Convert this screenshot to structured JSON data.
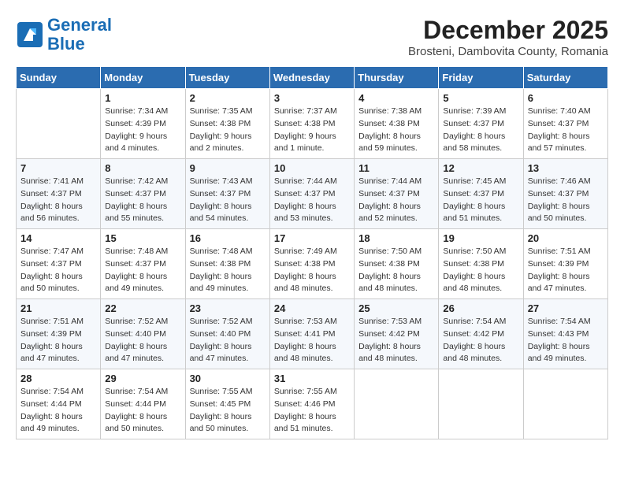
{
  "header": {
    "logo_line1": "General",
    "logo_line2": "Blue",
    "month_title": "December 2025",
    "subtitle": "Brosteni, Dambovita County, Romania"
  },
  "days_of_week": [
    "Sunday",
    "Monday",
    "Tuesday",
    "Wednesday",
    "Thursday",
    "Friday",
    "Saturday"
  ],
  "weeks": [
    [
      {
        "day": "",
        "sunrise": "",
        "sunset": "",
        "daylight": ""
      },
      {
        "day": "1",
        "sunrise": "Sunrise: 7:34 AM",
        "sunset": "Sunset: 4:39 PM",
        "daylight": "Daylight: 9 hours and 4 minutes."
      },
      {
        "day": "2",
        "sunrise": "Sunrise: 7:35 AM",
        "sunset": "Sunset: 4:38 PM",
        "daylight": "Daylight: 9 hours and 2 minutes."
      },
      {
        "day": "3",
        "sunrise": "Sunrise: 7:37 AM",
        "sunset": "Sunset: 4:38 PM",
        "daylight": "Daylight: 9 hours and 1 minute."
      },
      {
        "day": "4",
        "sunrise": "Sunrise: 7:38 AM",
        "sunset": "Sunset: 4:38 PM",
        "daylight": "Daylight: 8 hours and 59 minutes."
      },
      {
        "day": "5",
        "sunrise": "Sunrise: 7:39 AM",
        "sunset": "Sunset: 4:37 PM",
        "daylight": "Daylight: 8 hours and 58 minutes."
      },
      {
        "day": "6",
        "sunrise": "Sunrise: 7:40 AM",
        "sunset": "Sunset: 4:37 PM",
        "daylight": "Daylight: 8 hours and 57 minutes."
      }
    ],
    [
      {
        "day": "7",
        "sunrise": "Sunrise: 7:41 AM",
        "sunset": "Sunset: 4:37 PM",
        "daylight": "Daylight: 8 hours and 56 minutes."
      },
      {
        "day": "8",
        "sunrise": "Sunrise: 7:42 AM",
        "sunset": "Sunset: 4:37 PM",
        "daylight": "Daylight: 8 hours and 55 minutes."
      },
      {
        "day": "9",
        "sunrise": "Sunrise: 7:43 AM",
        "sunset": "Sunset: 4:37 PM",
        "daylight": "Daylight: 8 hours and 54 minutes."
      },
      {
        "day": "10",
        "sunrise": "Sunrise: 7:44 AM",
        "sunset": "Sunset: 4:37 PM",
        "daylight": "Daylight: 8 hours and 53 minutes."
      },
      {
        "day": "11",
        "sunrise": "Sunrise: 7:44 AM",
        "sunset": "Sunset: 4:37 PM",
        "daylight": "Daylight: 8 hours and 52 minutes."
      },
      {
        "day": "12",
        "sunrise": "Sunrise: 7:45 AM",
        "sunset": "Sunset: 4:37 PM",
        "daylight": "Daylight: 8 hours and 51 minutes."
      },
      {
        "day": "13",
        "sunrise": "Sunrise: 7:46 AM",
        "sunset": "Sunset: 4:37 PM",
        "daylight": "Daylight: 8 hours and 50 minutes."
      }
    ],
    [
      {
        "day": "14",
        "sunrise": "Sunrise: 7:47 AM",
        "sunset": "Sunset: 4:37 PM",
        "daylight": "Daylight: 8 hours and 50 minutes."
      },
      {
        "day": "15",
        "sunrise": "Sunrise: 7:48 AM",
        "sunset": "Sunset: 4:37 PM",
        "daylight": "Daylight: 8 hours and 49 minutes."
      },
      {
        "day": "16",
        "sunrise": "Sunrise: 7:48 AM",
        "sunset": "Sunset: 4:38 PM",
        "daylight": "Daylight: 8 hours and 49 minutes."
      },
      {
        "day": "17",
        "sunrise": "Sunrise: 7:49 AM",
        "sunset": "Sunset: 4:38 PM",
        "daylight": "Daylight: 8 hours and 48 minutes."
      },
      {
        "day": "18",
        "sunrise": "Sunrise: 7:50 AM",
        "sunset": "Sunset: 4:38 PM",
        "daylight": "Daylight: 8 hours and 48 minutes."
      },
      {
        "day": "19",
        "sunrise": "Sunrise: 7:50 AM",
        "sunset": "Sunset: 4:38 PM",
        "daylight": "Daylight: 8 hours and 48 minutes."
      },
      {
        "day": "20",
        "sunrise": "Sunrise: 7:51 AM",
        "sunset": "Sunset: 4:39 PM",
        "daylight": "Daylight: 8 hours and 47 minutes."
      }
    ],
    [
      {
        "day": "21",
        "sunrise": "Sunrise: 7:51 AM",
        "sunset": "Sunset: 4:39 PM",
        "daylight": "Daylight: 8 hours and 47 minutes."
      },
      {
        "day": "22",
        "sunrise": "Sunrise: 7:52 AM",
        "sunset": "Sunset: 4:40 PM",
        "daylight": "Daylight: 8 hours and 47 minutes."
      },
      {
        "day": "23",
        "sunrise": "Sunrise: 7:52 AM",
        "sunset": "Sunset: 4:40 PM",
        "daylight": "Daylight: 8 hours and 47 minutes."
      },
      {
        "day": "24",
        "sunrise": "Sunrise: 7:53 AM",
        "sunset": "Sunset: 4:41 PM",
        "daylight": "Daylight: 8 hours and 48 minutes."
      },
      {
        "day": "25",
        "sunrise": "Sunrise: 7:53 AM",
        "sunset": "Sunset: 4:42 PM",
        "daylight": "Daylight: 8 hours and 48 minutes."
      },
      {
        "day": "26",
        "sunrise": "Sunrise: 7:54 AM",
        "sunset": "Sunset: 4:42 PM",
        "daylight": "Daylight: 8 hours and 48 minutes."
      },
      {
        "day": "27",
        "sunrise": "Sunrise: 7:54 AM",
        "sunset": "Sunset: 4:43 PM",
        "daylight": "Daylight: 8 hours and 49 minutes."
      }
    ],
    [
      {
        "day": "28",
        "sunrise": "Sunrise: 7:54 AM",
        "sunset": "Sunset: 4:44 PM",
        "daylight": "Daylight: 8 hours and 49 minutes."
      },
      {
        "day": "29",
        "sunrise": "Sunrise: 7:54 AM",
        "sunset": "Sunset: 4:44 PM",
        "daylight": "Daylight: 8 hours and 50 minutes."
      },
      {
        "day": "30",
        "sunrise": "Sunrise: 7:55 AM",
        "sunset": "Sunset: 4:45 PM",
        "daylight": "Daylight: 8 hours and 50 minutes."
      },
      {
        "day": "31",
        "sunrise": "Sunrise: 7:55 AM",
        "sunset": "Sunset: 4:46 PM",
        "daylight": "Daylight: 8 hours and 51 minutes."
      },
      {
        "day": "",
        "sunrise": "",
        "sunset": "",
        "daylight": ""
      },
      {
        "day": "",
        "sunrise": "",
        "sunset": "",
        "daylight": ""
      },
      {
        "day": "",
        "sunrise": "",
        "sunset": "",
        "daylight": ""
      }
    ]
  ]
}
